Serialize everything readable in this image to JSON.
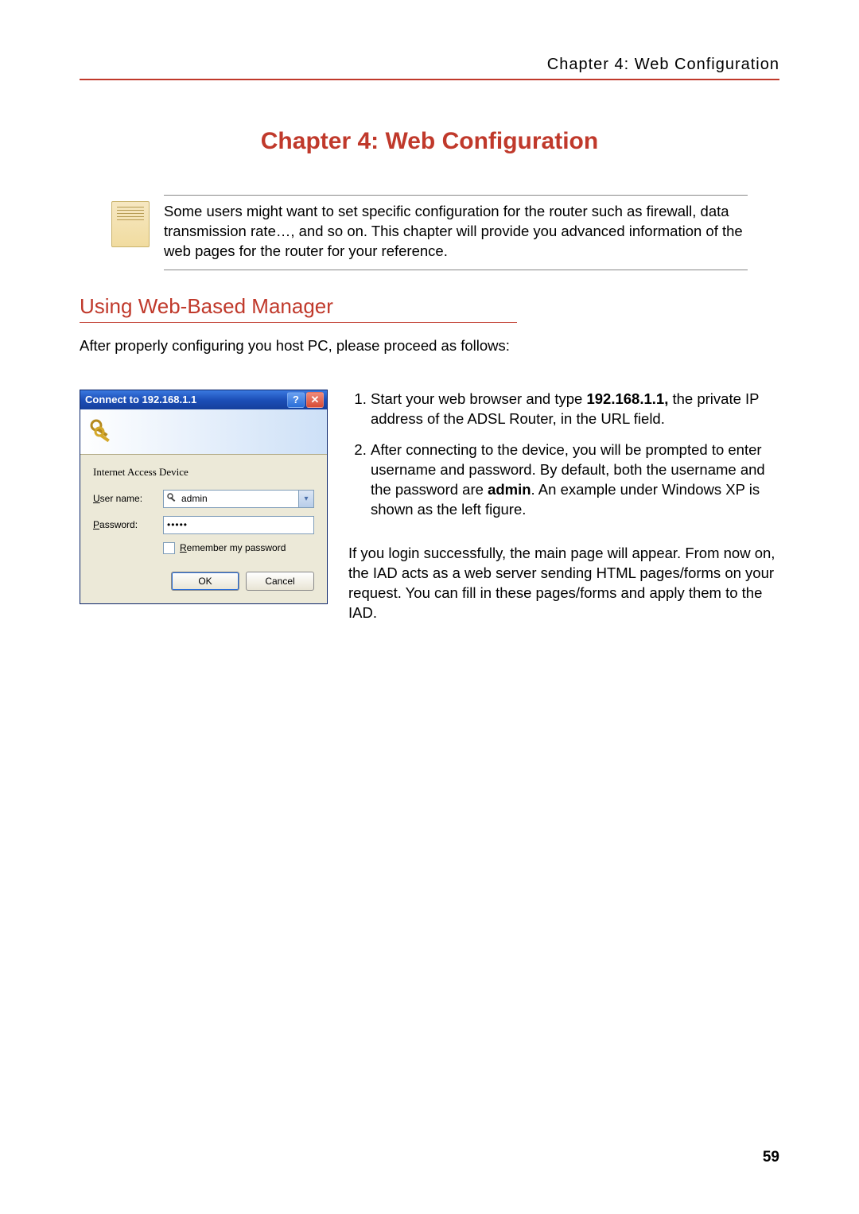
{
  "running_header": "Chapter 4: Web Configuration",
  "chapter_title": "Chapter 4: Web Configuration",
  "note_text": "Some users might want to set specific configuration for the router such as firewall, data transmission rate…, and so on. This chapter will provide you advanced information of the web pages for the router for your reference.",
  "section_heading": "Using Web-Based Manager",
  "intro_para": "After properly configuring you host PC, please proceed as follows:",
  "steps": {
    "item1_pre": "Start your web browser and type ",
    "item1_bold": "192.168.1.1,",
    "item1_post": " the private IP address of the ADSL Router, in the URL field.",
    "item2_pre": "After connecting to the device, you will be prompted to enter username and password. By default, both the username and the password are ",
    "item2_bold": "admin",
    "item2_post": ". An example under Windows XP is shown as the left figure."
  },
  "after_para": "If you login successfully, the main page will appear. From now on, the IAD acts as a web server sending HTML pages/forms on your request. You can fill in these pages/forms and apply them to the IAD.",
  "dialog": {
    "title": "Connect to 192.168.1.1",
    "device": "Internet Access Device",
    "user_label_u": "U",
    "user_label_rest": "ser name:",
    "user_value": "admin",
    "pass_label_p": "P",
    "pass_label_rest": "assword:",
    "pass_value": "•••••",
    "remember_r": "R",
    "remember_rest": "emember my password",
    "ok": "OK",
    "cancel": "Cancel"
  },
  "page_number": "59"
}
